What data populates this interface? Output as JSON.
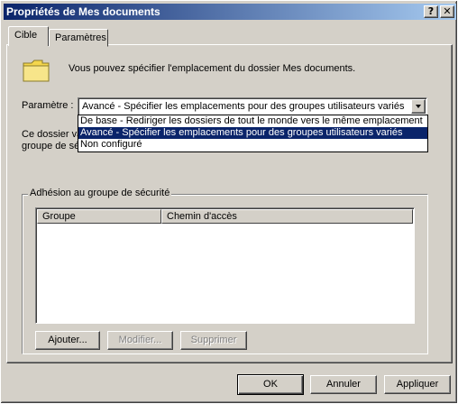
{
  "window": {
    "title": "Propriétés de Mes documents",
    "help_glyph": "?",
    "close_glyph": "✕"
  },
  "tabs": [
    {
      "label": "Cible",
      "active": true
    },
    {
      "label": "Paramètres",
      "active": false
    }
  ],
  "intro_text": "Vous pouvez spécifier l'emplacement du dossier Mes documents.",
  "setting": {
    "label": "Paramètre :",
    "selected": "Avancé - Spécifier les emplacements pour des groupes utilisateurs variés",
    "options": [
      "De base - Rediriger les dossiers de tout le monde vers le même emplacement",
      "Avancé - Spécifier les emplacements pour des groupes utilisateurs variés",
      "Non configuré"
    ]
  },
  "description_partial": {
    "line1": "Ce dossier va",
    "line2": "groupe de sé"
  },
  "membership": {
    "title": "Adhésion au groupe de sécurité",
    "columns": [
      "Groupe",
      "Chemin d'accès"
    ],
    "rows": [],
    "buttons": {
      "add": "Ajouter...",
      "modify": "Modifier...",
      "remove": "Supprimer"
    }
  },
  "footer_buttons": {
    "ok": "OK",
    "cancel": "Annuler",
    "apply": "Appliquer"
  },
  "colors": {
    "titlebar_start": "#0a246a",
    "titlebar_end": "#a6caf0",
    "face": "#d4d0c8",
    "selection": "#0a246a",
    "folder": "#f4d64c"
  },
  "icons": {
    "folder": "folder-icon",
    "dropdown": "chevron-down-icon"
  }
}
